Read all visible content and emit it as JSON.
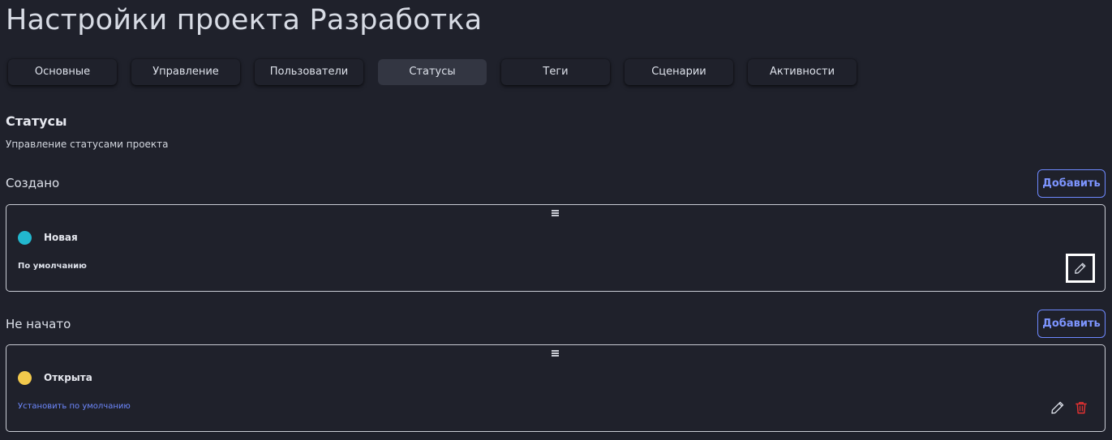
{
  "page": {
    "title": "Настройки проекта Разработка"
  },
  "tabs": [
    {
      "label": "Основные",
      "active": false
    },
    {
      "label": "Управление",
      "active": false
    },
    {
      "label": "Пользователи",
      "active": false
    },
    {
      "label": "Статусы",
      "active": true
    },
    {
      "label": "Теги",
      "active": false
    },
    {
      "label": "Сценарии",
      "active": false
    },
    {
      "label": "Активности",
      "active": false
    }
  ],
  "section": {
    "title": "Статусы",
    "subtitle": "Управление статусами проекта"
  },
  "groups": [
    {
      "label": "Создано",
      "add_label": "Добавить",
      "statuses": [
        {
          "name": "Новая",
          "color": "#22b8cf",
          "default_text": "По умолчанию",
          "is_default": true,
          "icons": [
            "drag-handle-icon",
            "pencil-icon"
          ]
        }
      ]
    },
    {
      "label": "Не начато",
      "add_label": "Добавить",
      "statuses": [
        {
          "name": "Открыта",
          "color": "#f2c94c",
          "default_text": "Установить по умолчанию",
          "is_default": false,
          "icons": [
            "drag-handle-icon",
            "pencil-icon",
            "trash-icon"
          ]
        }
      ]
    }
  ],
  "colors": {
    "background": "#1f212b",
    "accent": "#6e89ff",
    "danger": "#e03131",
    "active_tab": "#333642"
  }
}
